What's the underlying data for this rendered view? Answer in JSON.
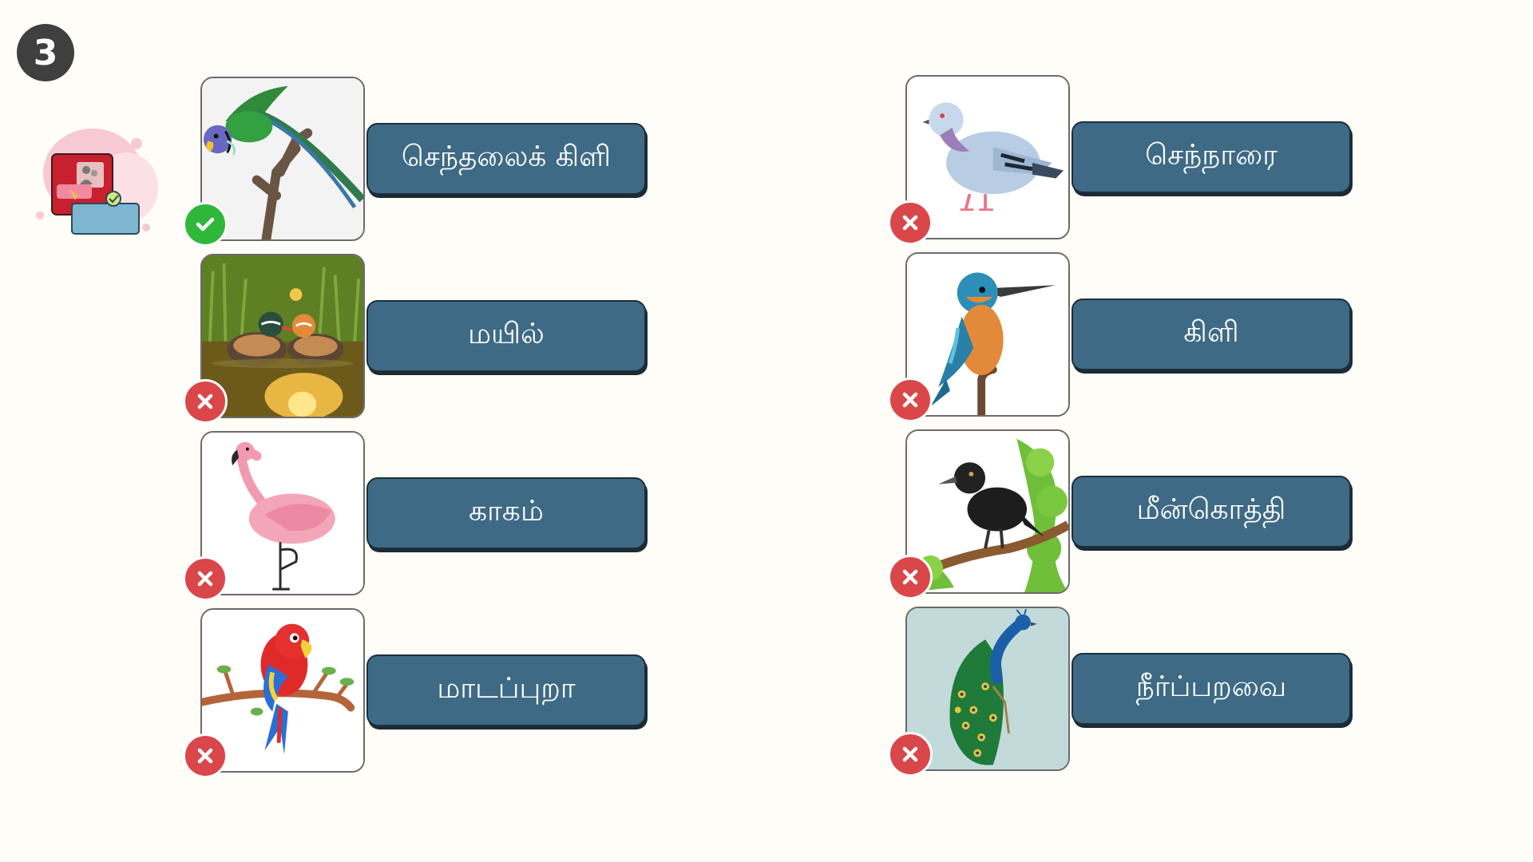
{
  "step": {
    "number": "3"
  },
  "left_column": [
    {
      "label": "செந்தலைக் கிளி",
      "image": "plum-headed-parakeet-image",
      "result": "correct"
    },
    {
      "label": "மயில்",
      "image": "mandarin-ducks-image",
      "result": "wrong"
    },
    {
      "label": "காகம்",
      "image": "flamingo-image",
      "result": "wrong"
    },
    {
      "label": "மாடப்புறா",
      "image": "red-parrot-image",
      "result": "wrong"
    }
  ],
  "right_column": [
    {
      "label": "செந்நாரை",
      "image": "pigeon-image",
      "result": "wrong"
    },
    {
      "label": "கிளி",
      "image": "kingfisher-image",
      "result": "wrong"
    },
    {
      "label": "மீன்கொத்தி",
      "image": "crow-image",
      "result": "wrong"
    },
    {
      "label": "நீர்ப்பறவை",
      "image": "peacock-image",
      "result": "wrong"
    }
  ],
  "colors": {
    "label_bg": "#3e6a85",
    "correct": "#2fb73a",
    "wrong": "#d9474b",
    "badge": "#3f3f3f"
  }
}
